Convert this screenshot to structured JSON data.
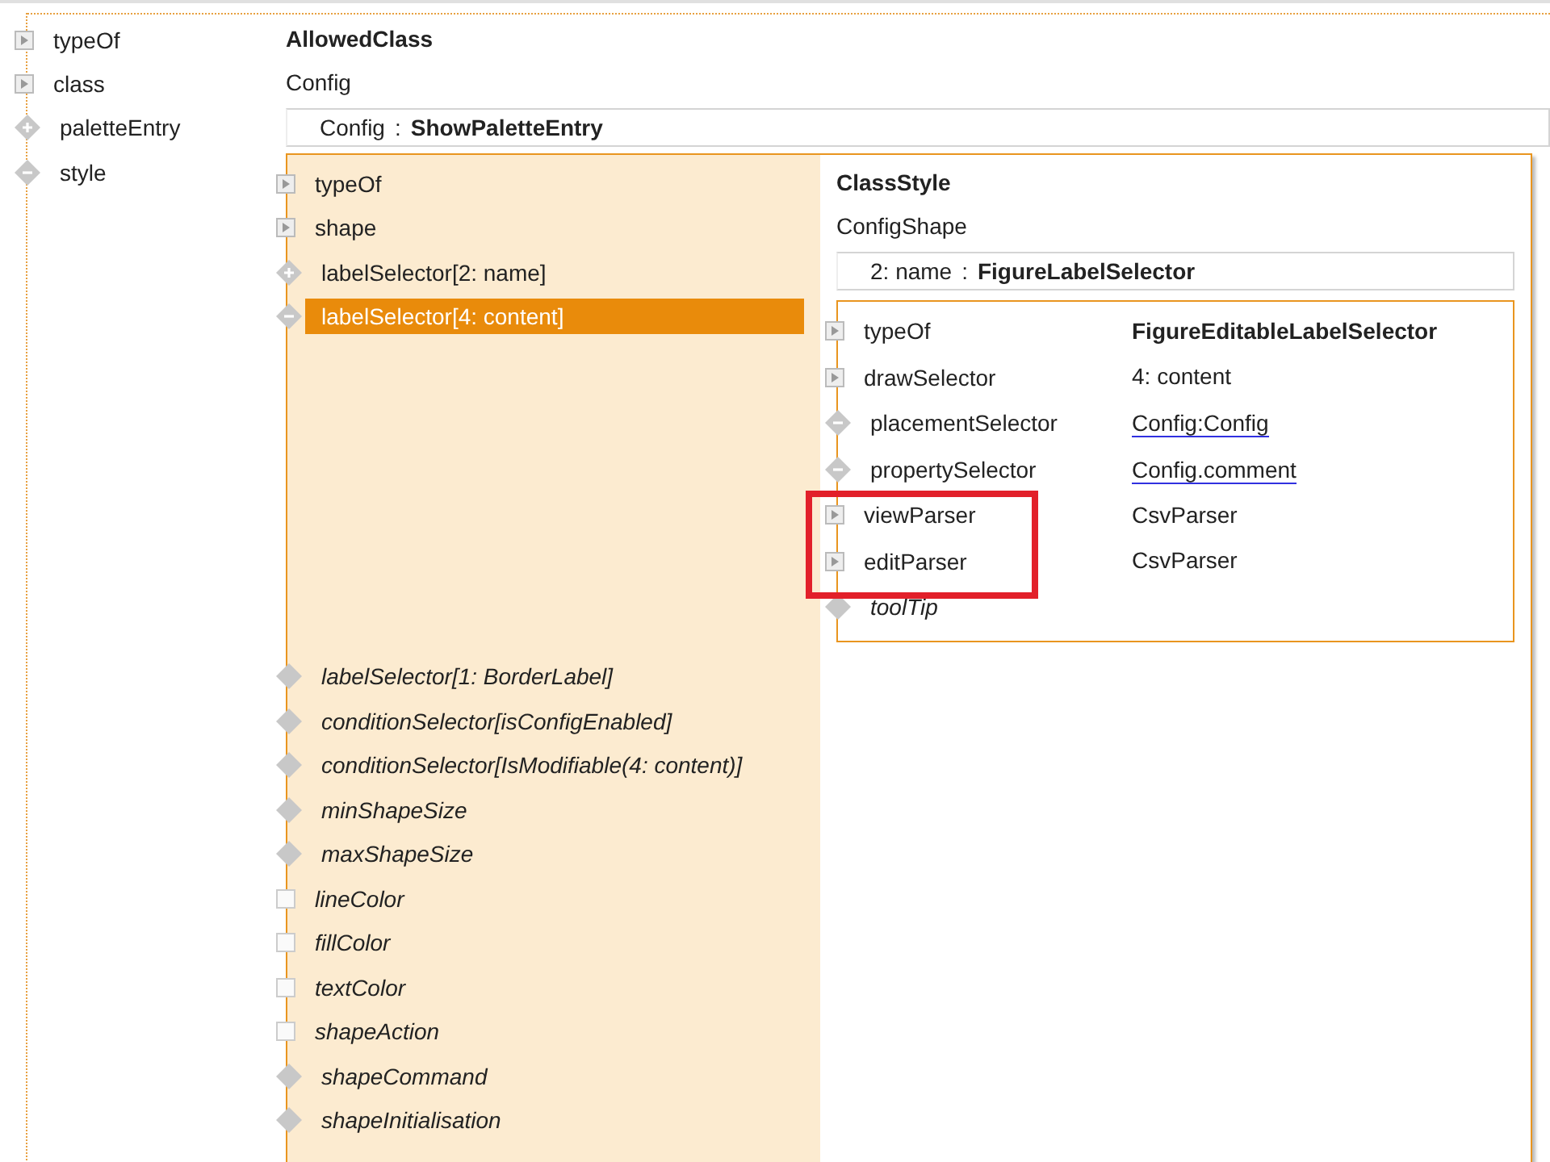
{
  "properties": [
    {
      "name": "typeOf",
      "kind": "attribute",
      "type": "AllowedClass"
    },
    {
      "name": "class",
      "kind": "attribute",
      "value": "Config"
    },
    {
      "name": "paletteEntry",
      "kind": "reference",
      "unset": false,
      "expanded": false,
      "ref": {
        "context": "Config",
        "separator": ":",
        "target": "ShowPaletteEntry"
      }
    },
    {
      "name": "style",
      "kind": "reference",
      "unset": false,
      "expanded": true,
      "object": {
        "title": "ClassStyle",
        "subtitle": "ConfigShape",
        "ref": {
          "context": "2: name",
          "separator": ":",
          "target": "FigureLabelSelector"
        },
        "members": [
          {
            "name": "typeOf",
            "kind": "attribute",
            "unset": false,
            "selected": false
          },
          {
            "name": "shape",
            "kind": "attribute",
            "unset": false,
            "selected": false
          },
          {
            "name": "labelSelector[2: name]",
            "kind": "reference",
            "unset": false,
            "expanded": false,
            "selected": false
          },
          {
            "name": "labelSelector[4: content]",
            "kind": "reference",
            "unset": false,
            "expanded": true,
            "selected": true,
            "detail": {
              "rows": [
                {
                  "name": "typeOf",
                  "kind": "attribute",
                  "type": "FigureEditableLabelSelector",
                  "unset": false,
                  "highlighted": false
                },
                {
                  "name": "drawSelector",
                  "kind": "attribute",
                  "value": "4: content",
                  "unset": false,
                  "highlighted": false
                },
                {
                  "name": "placementSelector",
                  "kind": "reference",
                  "expanded": true,
                  "link": "Config:Config",
                  "unset": false,
                  "highlighted": false
                },
                {
                  "name": "propertySelector",
                  "kind": "reference",
                  "expanded": true,
                  "link": "Config.comment",
                  "unset": false,
                  "highlighted": false
                },
                {
                  "name": "viewParser",
                  "kind": "attribute",
                  "value": "CsvParser",
                  "unset": false,
                  "highlighted": true
                },
                {
                  "name": "editParser",
                  "kind": "attribute",
                  "value": "CsvParser",
                  "unset": false,
                  "highlighted": true
                },
                {
                  "name": "toolTip",
                  "kind": "reference",
                  "unset": true,
                  "highlighted": false
                }
              ]
            }
          },
          {
            "name": "labelSelector[1: BorderLabel]",
            "kind": "reference",
            "unset": true,
            "selected": false
          },
          {
            "name": "conditionSelector[isConfigEnabled]",
            "kind": "reference",
            "unset": true,
            "selected": false
          },
          {
            "name": "conditionSelector[IsModifiable(4: content)]",
            "kind": "reference",
            "unset": true,
            "selected": false
          },
          {
            "name": "minShapeSize",
            "kind": "reference",
            "unset": true,
            "selected": false
          },
          {
            "name": "maxShapeSize",
            "kind": "reference",
            "unset": true,
            "selected": false
          },
          {
            "name": "lineColor",
            "kind": "color",
            "unset": true,
            "selected": false
          },
          {
            "name": "fillColor",
            "kind": "color",
            "unset": true,
            "selected": false
          },
          {
            "name": "textColor",
            "kind": "color",
            "unset": true,
            "selected": false
          },
          {
            "name": "shapeAction",
            "kind": "color",
            "unset": true,
            "selected": false
          },
          {
            "name": "shapeCommand",
            "kind": "reference",
            "unset": true,
            "selected": false
          },
          {
            "name": "shapeInitialisation",
            "kind": "reference",
            "unset": true,
            "selected": false
          }
        ]
      }
    }
  ]
}
